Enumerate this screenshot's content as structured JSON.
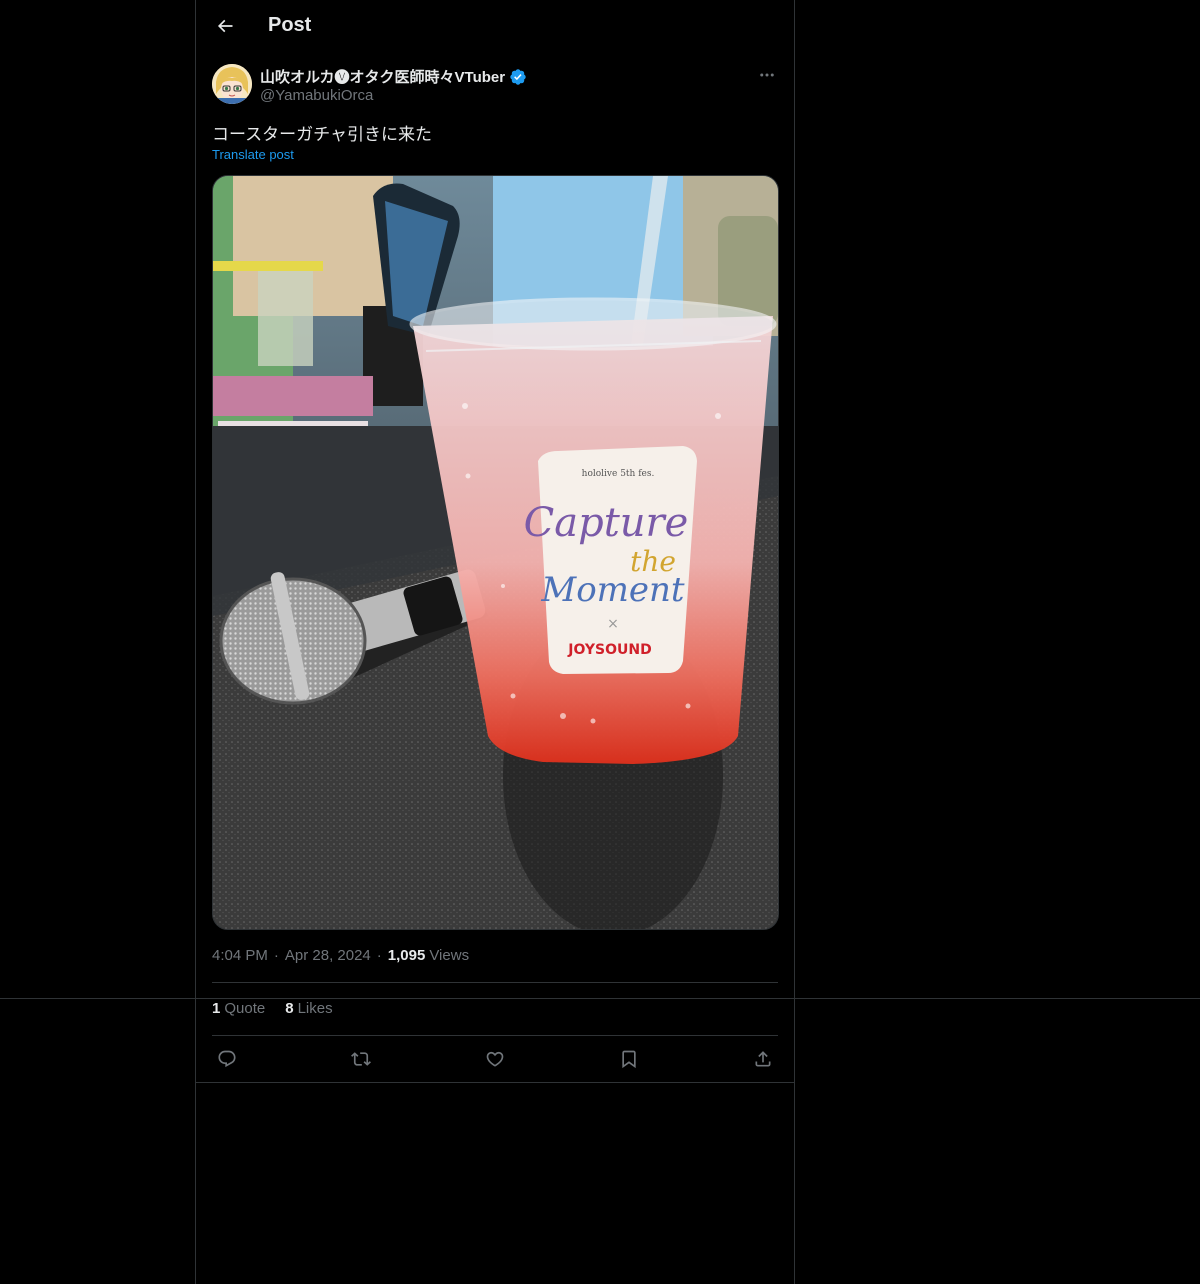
{
  "header": {
    "title": "Post"
  },
  "author": {
    "display_name": "山吹オルカ🅥オタク医師時々VTuber",
    "handle": "@YamabukiOrca",
    "verified": true
  },
  "post": {
    "text": "コースターガチャ引きに来た",
    "translate_label": "Translate post",
    "media": {
      "cup_label_lines": [
        "hololive 5th fes.",
        "Capture",
        "the",
        "Moment"
      ],
      "collab_x": "×",
      "brand": "JOYSOUND"
    }
  },
  "meta": {
    "time": "4:04 PM",
    "date": "Apr 28, 2024",
    "views_count": "1,095",
    "views_label": "Views"
  },
  "stats": {
    "quotes_count": "1",
    "quotes_label": "Quote",
    "likes_count": "8",
    "likes_label": "Likes"
  },
  "colors": {
    "background": "#000000",
    "text": "#e7e9ea",
    "muted": "#71767b",
    "link": "#1d9bf0",
    "border": "#2f3336"
  },
  "icons": {
    "back": "arrow-left-icon",
    "more": "more-horizontal-icon",
    "verified": "verified-badge-icon",
    "reply": "reply-icon",
    "repost": "repost-icon",
    "like": "heart-icon",
    "bookmark": "bookmark-icon",
    "share": "share-icon"
  }
}
